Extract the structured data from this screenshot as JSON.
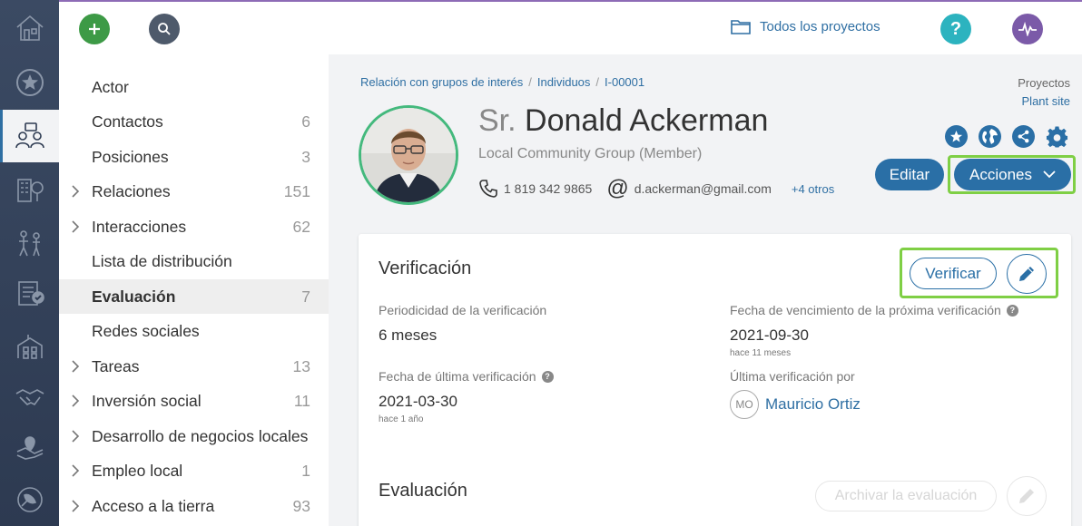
{
  "topbar": {
    "all_projects": "Todos los proyectos",
    "help_symbol": "?"
  },
  "rail": {
    "icons": [
      "home-icon",
      "star-icon",
      "stakeholders-icon",
      "organizations-icon",
      "groups-icon",
      "tasks-icon",
      "locations-icon",
      "agreements-icon",
      "map-icon",
      "environment-icon"
    ]
  },
  "subnav": {
    "items": [
      {
        "label": "Actor",
        "count": "",
        "expandable": false
      },
      {
        "label": "Contactos",
        "count": "6",
        "expandable": false
      },
      {
        "label": "Posiciones",
        "count": "3",
        "expandable": false
      },
      {
        "label": "Relaciones",
        "count": "151",
        "expandable": true
      },
      {
        "label": "Interacciones",
        "count": "62",
        "expandable": true
      },
      {
        "label": "Lista de distribución",
        "count": "",
        "expandable": false
      },
      {
        "label": "Evaluación",
        "count": "7",
        "expandable": false,
        "active": true
      },
      {
        "label": "Redes sociales",
        "count": "",
        "expandable": false
      },
      {
        "label": "Tareas",
        "count": "13",
        "expandable": true
      },
      {
        "label": "Inversión social",
        "count": "11",
        "expandable": true
      },
      {
        "label": "Desarrollo de negocios locales",
        "count": "",
        "expandable": true
      },
      {
        "label": "Empleo local",
        "count": "1",
        "expandable": true
      },
      {
        "label": "Acceso a la tierra",
        "count": "93",
        "expandable": true
      }
    ]
  },
  "breadcrumb": {
    "items": [
      "Relación con grupos de interés",
      "Individuos",
      "I-00001"
    ],
    "separator": "/"
  },
  "projects": {
    "label": "Proyectos",
    "value": "Plant site"
  },
  "profile": {
    "salutation": "Sr.",
    "name": "Donald Ackerman",
    "subtitle": "Local Community Group (Member)",
    "phone": "1 819 342 9865",
    "at_symbol": "@",
    "email": "d.ackerman@gmail.com",
    "more": "+4 otros"
  },
  "actions": {
    "edit": "Editar",
    "actions": "Acciones"
  },
  "verification": {
    "title": "Verificación",
    "verify_button": "Verificar",
    "periodicity_label": "Periodicidad de la verificación",
    "periodicity_value": "6 meses",
    "next_due_label": "Fecha de vencimiento de la próxima verificación",
    "next_due_value": "2021-09-30",
    "next_due_relative": "hace 11 meses",
    "last_label": "Fecha de última verificación",
    "last_value": "2021-03-30",
    "last_relative": "hace 1 año",
    "by_label": "Última verificación por",
    "by_initials": "MO",
    "by_name": "Mauricio Ortiz"
  },
  "evaluation": {
    "title": "Evaluación",
    "archive_button": "Archivar la evaluación"
  },
  "colors": {
    "accent": "#2a6fa6",
    "highlight": "#7fcf45",
    "rail": "#334259",
    "add": "#3d9a46",
    "help": "#2cb3bf",
    "activity": "#7b5aa8"
  }
}
